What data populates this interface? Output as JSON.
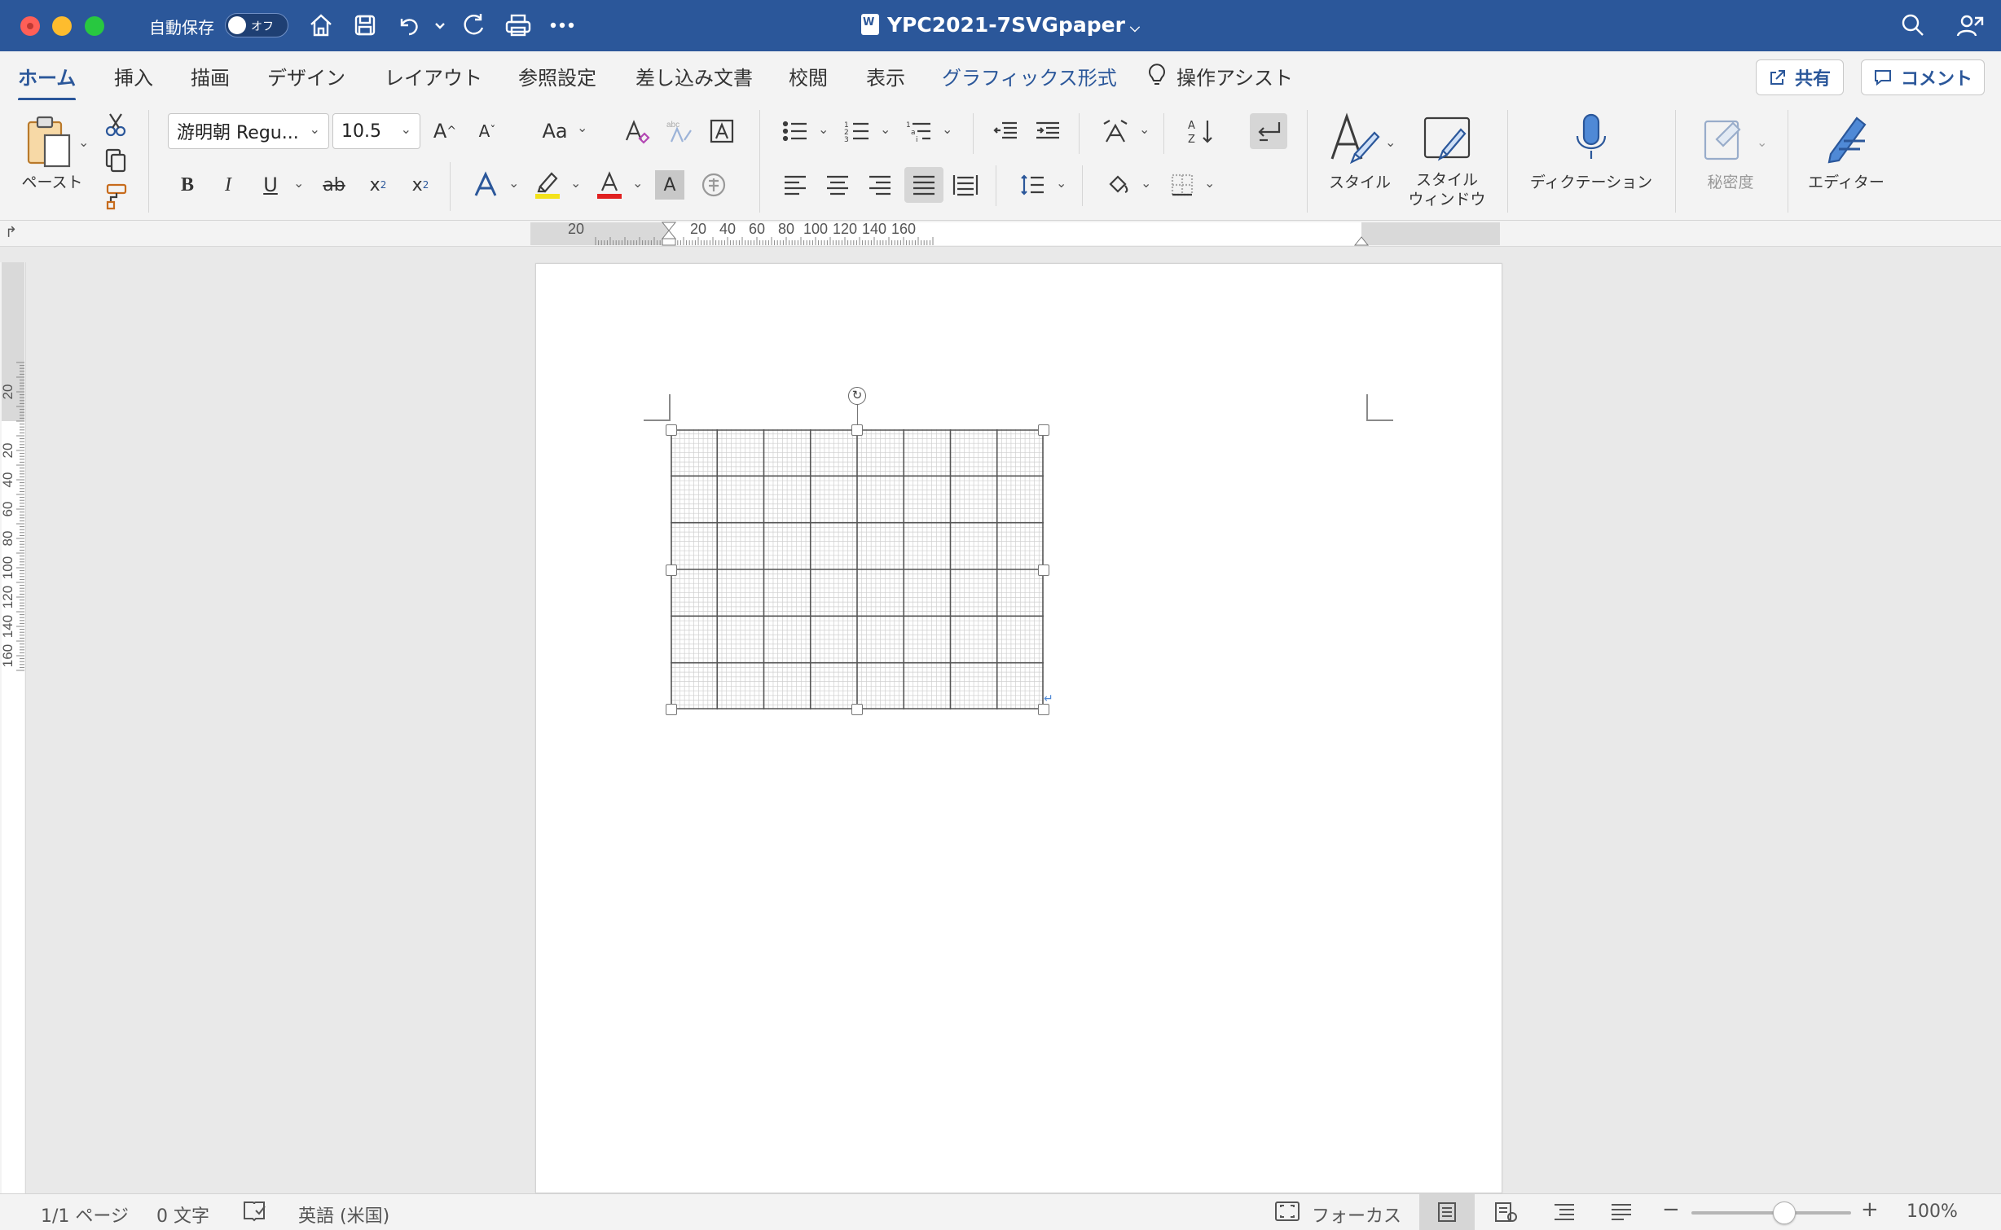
{
  "window": {
    "title": "YPC2021-7SVGpaper",
    "autosave_label": "自動保存",
    "autosave_state": "オフ",
    "title_icon": "word-doc-icon"
  },
  "titlebar_icons": [
    "home-icon",
    "save-icon",
    "undo-icon",
    "redo-icon",
    "print-icon",
    "more-icon",
    "search-icon",
    "share-person-icon"
  ],
  "tabs": [
    {
      "label": "ホーム",
      "active": true
    },
    {
      "label": "挿入"
    },
    {
      "label": "描画"
    },
    {
      "label": "デザイン"
    },
    {
      "label": "レイアウト"
    },
    {
      "label": "参照設定"
    },
    {
      "label": "差し込み文書"
    },
    {
      "label": "校閲"
    },
    {
      "label": "表示"
    },
    {
      "label": "グラフィックス形式",
      "contextual": true
    },
    {
      "label": "操作アシスト",
      "icon": "lightbulb-icon"
    }
  ],
  "header_buttons": {
    "share": "共有",
    "comment": "コメント"
  },
  "ribbon": {
    "paste_label": "ペースト",
    "font_name": "游明朝 Regu...",
    "font_size": "10.5",
    "change_case": "Aa",
    "bold": "B",
    "italic": "I",
    "underline": "U",
    "strikethrough": "ab",
    "subscript": "x",
    "subscript_mark": "2",
    "superscript": "x",
    "superscript_mark": "2",
    "styles_label": "スタイル",
    "styles_pane_label_1": "スタイル",
    "styles_pane_label_2": "ウィンドウ",
    "dictation_label": "ディクテーション",
    "sensitivity_label": "秘密度",
    "editor_label": "エディター",
    "accent_color": "#2b579a",
    "highlight_color": "#f3e21b",
    "font_color": "#e02020"
  },
  "ruler": {
    "h_labels": [
      "20",
      "20",
      "40",
      "60",
      "80",
      "100",
      "120",
      "140",
      "160"
    ],
    "v_labels": [
      "20",
      "20",
      "40",
      "60",
      "80",
      "100",
      "120",
      "140",
      "160"
    ]
  },
  "status": {
    "page": "1/1 ページ",
    "words": "0 文字",
    "language": "英語 (米国)",
    "focus": "フォーカス",
    "zoom": "100%",
    "zoom_minus": "−",
    "zoom_plus": "+",
    "zoom_level": 1.0
  }
}
